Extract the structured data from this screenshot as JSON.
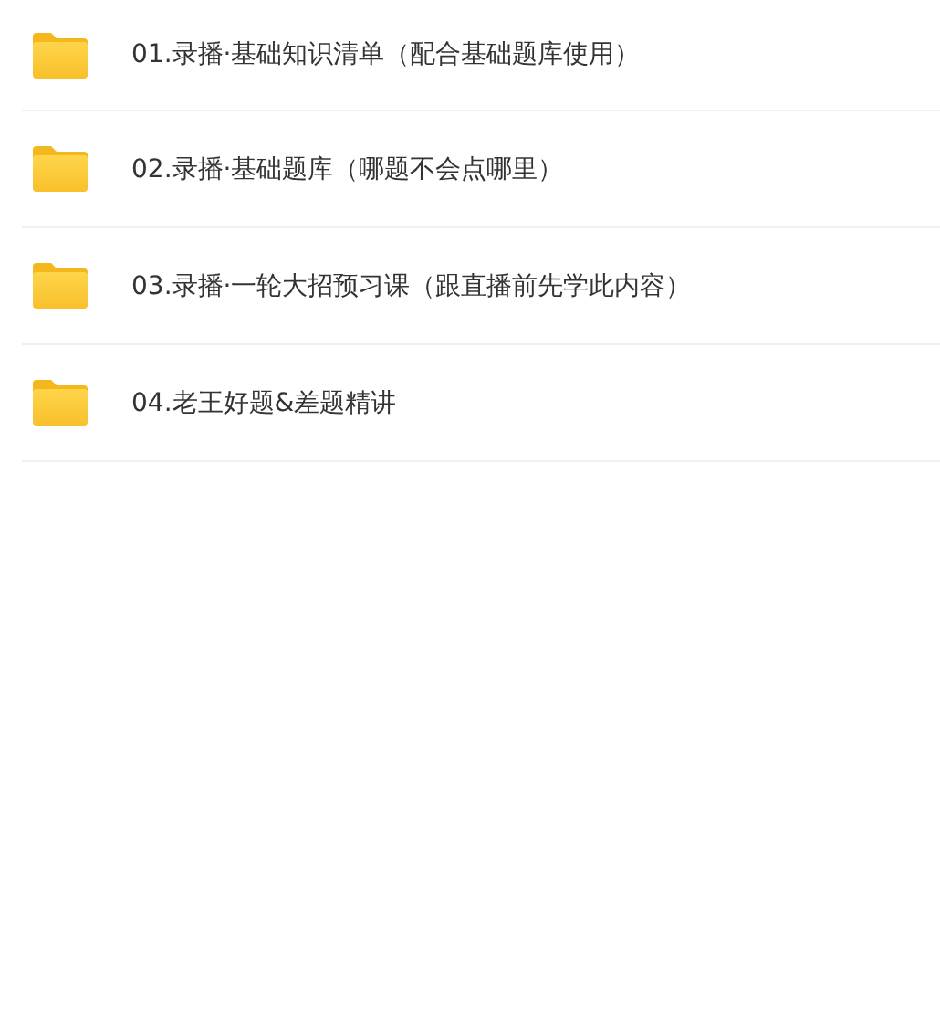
{
  "folders": [
    {
      "name": "01.录播·基础知识清单（配合基础题库使用）"
    },
    {
      "name": "02.录播·基础题库（哪题不会点哪里）"
    },
    {
      "name": "03.录播·一轮大招预习课（跟直播前先学此内容）"
    },
    {
      "name": "04.老王好题&差题精讲"
    }
  ]
}
